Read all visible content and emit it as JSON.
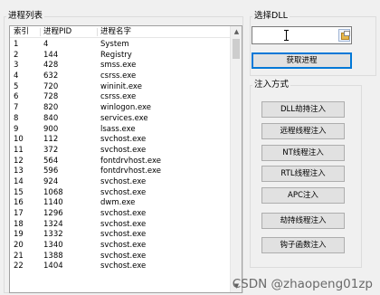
{
  "process_group": {
    "title": "进程列表"
  },
  "process_list": {
    "columns": [
      "索引",
      "进程PID",
      "进程名字"
    ],
    "rows": [
      [
        "1",
        "4",
        "System"
      ],
      [
        "2",
        "144",
        "Registry"
      ],
      [
        "3",
        "428",
        "smss.exe"
      ],
      [
        "4",
        "632",
        "csrss.exe"
      ],
      [
        "5",
        "720",
        "wininit.exe"
      ],
      [
        "6",
        "728",
        "csrss.exe"
      ],
      [
        "7",
        "820",
        "winlogon.exe"
      ],
      [
        "8",
        "840",
        "services.exe"
      ],
      [
        "9",
        "900",
        "lsass.exe"
      ],
      [
        "10",
        "112",
        "svchost.exe"
      ],
      [
        "11",
        "372",
        "svchost.exe"
      ],
      [
        "12",
        "564",
        "fontdrvhost.exe"
      ],
      [
        "13",
        "596",
        "fontdrvhost.exe"
      ],
      [
        "14",
        "924",
        "svchost.exe"
      ],
      [
        "15",
        "1068",
        "svchost.exe"
      ],
      [
        "16",
        "1140",
        "dwm.exe"
      ],
      [
        "17",
        "1296",
        "svchost.exe"
      ],
      [
        "18",
        "1324",
        "svchost.exe"
      ],
      [
        "19",
        "1332",
        "svchost.exe"
      ],
      [
        "20",
        "1340",
        "svchost.exe"
      ],
      [
        "21",
        "1388",
        "svchost.exe"
      ],
      [
        "22",
        "1404",
        "svchost.exe"
      ]
    ]
  },
  "dll_group": {
    "title": "选择DLL",
    "path_value": "",
    "get_process_label": "获取进程"
  },
  "inject_group": {
    "title": "注入方式",
    "buttons": [
      "DLL劫持注入",
      "远程线程注入",
      "NT线程注入",
      "RTL线程注入",
      "APC注入",
      "劫持线程注入",
      "钩子函数注入"
    ]
  },
  "icons": {
    "browse": "folder-browse-icon"
  },
  "colors": {
    "focus_border": "#0078d7",
    "window_bg": "#f0f0f0"
  },
  "watermark": "CSDN @zhaopeng01zp"
}
